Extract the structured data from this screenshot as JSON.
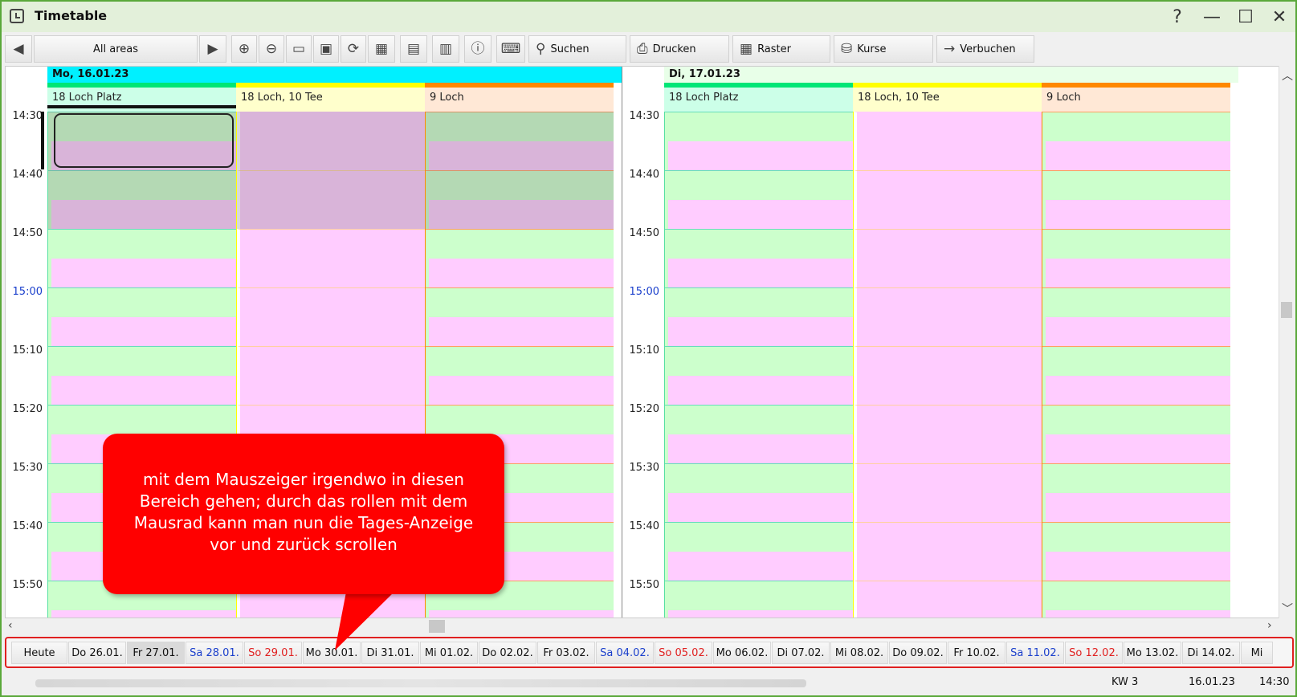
{
  "window": {
    "title": "Timetable",
    "controls": [
      "?",
      "—",
      "☐",
      "✕"
    ]
  },
  "toolbar": {
    "area_selector": "All areas",
    "search_label": "Suchen",
    "print_label": "Drucken",
    "grid_label": "Raster",
    "courses_label": "Kurse",
    "book_label": "Verbuchen"
  },
  "days": [
    {
      "date_label": "Mo, 16.01.23",
      "header_color": "#00f0ff",
      "resources": [
        {
          "name": "18 Loch Platz",
          "color": "#00e676",
          "bg": "#ccffe8"
        },
        {
          "name": "18 Loch, 10 Tee",
          "color": "#ffff00",
          "bg": "#ffffcc"
        },
        {
          "name": "9 Loch",
          "color": "#ff8800",
          "bg": "#ffe8d6"
        }
      ]
    },
    {
      "date_label": "Di, 17.01.23",
      "header_color": "#e8ffe8",
      "resources": [
        {
          "name": "18 Loch Platz",
          "color": "#00e676",
          "bg": "#ccffe8"
        },
        {
          "name": "18 Loch, 10 Tee",
          "color": "#ffff00",
          "bg": "#ffffcc"
        },
        {
          "name": "9 Loch",
          "color": "#ff8800",
          "bg": "#ffe8d6"
        }
      ]
    }
  ],
  "time_labels": [
    "14:30",
    "14:40",
    "14:50",
    "15:00",
    "15:10",
    "15:20",
    "15:30",
    "15:40",
    "15:50"
  ],
  "callout_text": "mit dem Mauszeiger irgendwo in diesen Bereich gehen; durch das rollen mit dem Mausrad kann man nun die Tages-Anzeige vor und zurück scrollen",
  "date_strip": [
    {
      "label": "Heute",
      "type": "normal"
    },
    {
      "label": "Do 26.01.",
      "type": "normal"
    },
    {
      "label": "Fr 27.01.",
      "type": "selected"
    },
    {
      "label": "Sa 28.01.",
      "type": "saturday"
    },
    {
      "label": "So 29.01.",
      "type": "sunday"
    },
    {
      "label": "Mo 30.01.",
      "type": "normal"
    },
    {
      "label": "Di 31.01.",
      "type": "normal"
    },
    {
      "label": "Mi 01.02.",
      "type": "normal"
    },
    {
      "label": "Do 02.02.",
      "type": "normal"
    },
    {
      "label": "Fr 03.02.",
      "type": "normal"
    },
    {
      "label": "Sa 04.02.",
      "type": "saturday"
    },
    {
      "label": "So 05.02.",
      "type": "sunday"
    },
    {
      "label": "Mo 06.02.",
      "type": "normal"
    },
    {
      "label": "Di 07.02.",
      "type": "normal"
    },
    {
      "label": "Mi 08.02.",
      "type": "normal"
    },
    {
      "label": "Do 09.02.",
      "type": "normal"
    },
    {
      "label": "Fr 10.02.",
      "type": "normal"
    },
    {
      "label": "Sa 11.02.",
      "type": "saturday"
    },
    {
      "label": "So 12.02.",
      "type": "sunday"
    },
    {
      "label": "Mo 13.02.",
      "type": "normal"
    },
    {
      "label": "Di 14.02.",
      "type": "normal"
    },
    {
      "label": "Mi",
      "type": "normal"
    }
  ],
  "status": {
    "week": "KW 3",
    "date": "16.01.23",
    "time": "14:30"
  },
  "colors": {
    "slot_green": "#ccffcc",
    "slot_pink": "#ffccff",
    "saturday": "#1a3fcc",
    "sunday": "#e02020",
    "highlight_time": "#1a3fcc"
  }
}
